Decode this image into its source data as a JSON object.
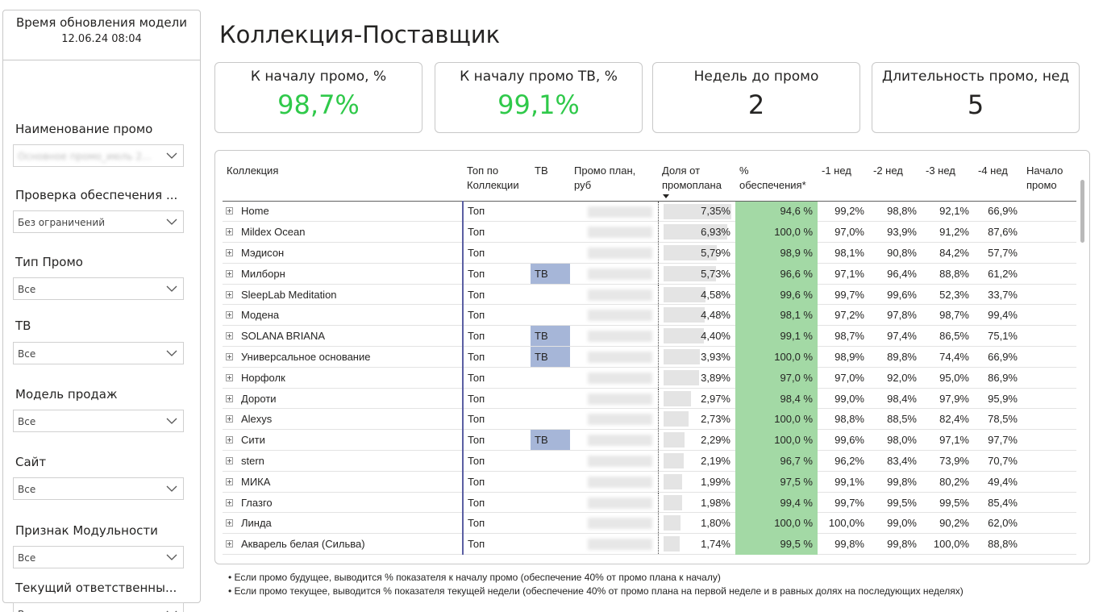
{
  "sidebar": {
    "model_time_label": "Время обновления модели",
    "model_time_value": "12.06.24 08:04",
    "filters": [
      {
        "label": "Наименование промо",
        "value": "Основное промо_июль 2..."
      },
      {
        "label": "Проверка обеспечения ...",
        "value": "Без ограничений"
      },
      {
        "label": "Тип Промо",
        "value": "Все"
      },
      {
        "label": "ТВ",
        "value": "Все"
      },
      {
        "label": "Модель продаж",
        "value": "Все"
      },
      {
        "label": "Сайт",
        "value": "Все"
      },
      {
        "label": "Признак Модульности",
        "value": "Все"
      },
      {
        "label": "Текущий ответственны...",
        "value": "Все"
      }
    ]
  },
  "header": {
    "title": "Коллекция-Поставщик"
  },
  "kpis": [
    {
      "label": "К началу промо, %",
      "value": "98,7%",
      "color": "#2fc94a"
    },
    {
      "label": "К началу промо ТВ, %",
      "value": "99,1%",
      "color": "#2fc94a"
    },
    {
      "label": "Недель до промо",
      "value": "2",
      "color": "#252423"
    },
    {
      "label": "Длительность промо, нед",
      "value": "5",
      "color": "#252423"
    }
  ],
  "table": {
    "columns": [
      "Коллекция",
      "Топ по Коллекции",
      "ТВ",
      "Промо план, руб",
      "Доля от промоплана",
      "% обеспечения*",
      "-1 нед",
      "-2 нед",
      "-3 нед",
      "-4 нед",
      "Начало промо"
    ],
    "rows": [
      {
        "name": "Home",
        "top": "Топ",
        "tv": "",
        "share": "7,35%",
        "share_pct": 7.35,
        "prov": "94,6 %",
        "w1": "99,2%",
        "w2": "98,8%",
        "w3": "92,1%",
        "w4": "66,9%"
      },
      {
        "name": "Mildex Ocean",
        "top": "Топ",
        "tv": "",
        "share": "6,93%",
        "share_pct": 6.93,
        "prov": "100,0 %",
        "w1": "97,0%",
        "w2": "93,9%",
        "w3": "91,2%",
        "w4": "87,6%"
      },
      {
        "name": "Мэдисон",
        "top": "Топ",
        "tv": "",
        "share": "5,79%",
        "share_pct": 5.79,
        "prov": "98,9 %",
        "w1": "98,1%",
        "w2": "90,8%",
        "w3": "84,2%",
        "w4": "57,7%"
      },
      {
        "name": "Милборн",
        "top": "Топ",
        "tv": "ТВ",
        "share": "5,73%",
        "share_pct": 5.73,
        "prov": "96,6 %",
        "w1": "97,1%",
        "w2": "96,4%",
        "w3": "88,8%",
        "w4": "61,2%"
      },
      {
        "name": "SleepLab Meditation",
        "top": "Топ",
        "tv": "",
        "share": "4,58%",
        "share_pct": 4.58,
        "prov": "99,6 %",
        "w1": "99,7%",
        "w2": "99,6%",
        "w3": "52,3%",
        "w4": "33,7%"
      },
      {
        "name": "Модена",
        "top": "Топ",
        "tv": "",
        "share": "4,48%",
        "share_pct": 4.48,
        "prov": "98,1 %",
        "w1": "97,2%",
        "w2": "97,8%",
        "w3": "98,7%",
        "w4": "99,4%"
      },
      {
        "name": "SOLANA BRIANA",
        "top": "Топ",
        "tv": "ТВ",
        "share": "4,40%",
        "share_pct": 4.4,
        "prov": "99,1 %",
        "w1": "98,7%",
        "w2": "97,4%",
        "w3": "86,5%",
        "w4": "75,1%"
      },
      {
        "name": "Универсальное основание",
        "top": "Топ",
        "tv": "ТВ",
        "share": "3,93%",
        "share_pct": 3.93,
        "prov": "100,0 %",
        "w1": "98,9%",
        "w2": "89,8%",
        "w3": "74,4%",
        "w4": "66,9%"
      },
      {
        "name": "Норфолк",
        "top": "Топ",
        "tv": "",
        "share": "3,89%",
        "share_pct": 3.89,
        "prov": "97,0 %",
        "w1": "97,0%",
        "w2": "92,0%",
        "w3": "95,0%",
        "w4": "86,9%"
      },
      {
        "name": "Дороти",
        "top": "Топ",
        "tv": "",
        "share": "2,97%",
        "share_pct": 2.97,
        "prov": "98,4 %",
        "w1": "99,0%",
        "w2": "98,4%",
        "w3": "97,9%",
        "w4": "95,9%"
      },
      {
        "name": "Alexys",
        "top": "Топ",
        "tv": "",
        "share": "2,73%",
        "share_pct": 2.73,
        "prov": "100,0 %",
        "w1": "98,8%",
        "w2": "88,5%",
        "w3": "82,4%",
        "w4": "78,5%"
      },
      {
        "name": "Сити",
        "top": "Топ",
        "tv": "ТВ",
        "share": "2,29%",
        "share_pct": 2.29,
        "prov": "100,0 %",
        "w1": "99,6%",
        "w2": "98,0%",
        "w3": "97,1%",
        "w4": "97,7%"
      },
      {
        "name": "stern",
        "top": "Топ",
        "tv": "",
        "share": "2,19%",
        "share_pct": 2.19,
        "prov": "96,7 %",
        "w1": "96,2%",
        "w2": "83,4%",
        "w3": "73,9%",
        "w4": "70,7%"
      },
      {
        "name": "МИКА",
        "top": "Топ",
        "tv": "",
        "share": "1,99%",
        "share_pct": 1.99,
        "prov": "97,5 %",
        "w1": "99,1%",
        "w2": "99,8%",
        "w3": "80,2%",
        "w4": "49,4%"
      },
      {
        "name": "Глазго",
        "top": "Топ",
        "tv": "",
        "share": "1,98%",
        "share_pct": 1.98,
        "prov": "99,4 %",
        "w1": "99,7%",
        "w2": "99,5%",
        "w3": "99,5%",
        "w4": "85,4%"
      },
      {
        "name": "Линда",
        "top": "Топ",
        "tv": "",
        "share": "1,80%",
        "share_pct": 1.8,
        "prov": "100,0 %",
        "w1": "100,0%",
        "w2": "99,0%",
        "w3": "90,2%",
        "w4": "62,0%"
      },
      {
        "name": "Акварель белая (Сильва)",
        "top": "Топ",
        "tv": "",
        "share": "1,74%",
        "share_pct": 1.74,
        "prov": "99,5 %",
        "w1": "99,8%",
        "w2": "99,8%",
        "w3": "100,0%",
        "w4": "88,8%"
      }
    ]
  },
  "notes": [
    "• Если промо будущее, выводится % показателя к началу промо (обеспечение 40% от промо плана к началу)",
    "• Если промо текущее, выводится % показателя текущей недели (обеспечение 40% от промо плана на первой неделе и в равных долях на последующих неделях)"
  ]
}
